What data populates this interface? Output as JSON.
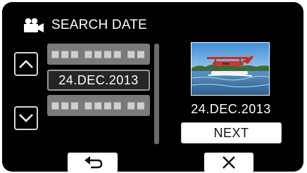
{
  "header": {
    "title": "SEARCH DATE",
    "icon": "video-camera-icon"
  },
  "date_list": {
    "items": [
      {
        "label": "■■■ ■■■■ ■■",
        "state": "placeholder"
      },
      {
        "label": "24.DEC.2013",
        "state": "selected"
      },
      {
        "label": "■■■ ■■■■ ■■",
        "state": "placeholder"
      }
    ],
    "up_icon": "chevron-up-icon",
    "down_icon": "chevron-down-icon"
  },
  "preview": {
    "thumbnail": "seaplane-thumbnail",
    "date": "24.DEC.2013"
  },
  "buttons": {
    "next_label": "NEXT",
    "back_icon": "return-arrow-icon",
    "close_icon": "close-icon"
  },
  "colors": {
    "background": "#000000",
    "selected_item": "#262626",
    "placeholder_item": "#8a8a8a"
  }
}
